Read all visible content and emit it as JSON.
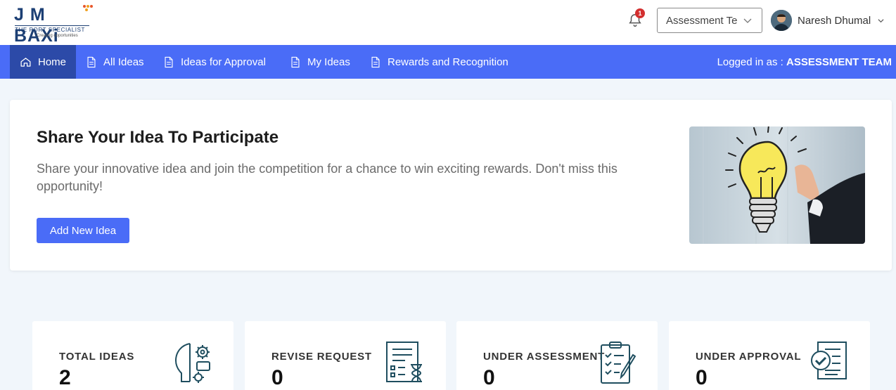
{
  "header": {
    "logo_brand": "J M BAXi",
    "logo_tagline": "THE PORT SPECIALIST",
    "logo_subtagline": "Creating opportunities",
    "notification_count": "1",
    "role_select_value": "Assessment Team",
    "user_name": "Naresh Dhumal"
  },
  "nav": {
    "items": [
      {
        "label": "Home",
        "icon": "home-icon"
      },
      {
        "label": "All Ideas",
        "icon": "document-icon"
      },
      {
        "label": "Ideas for Approval",
        "icon": "document-icon"
      },
      {
        "label": "My Ideas",
        "icon": "document-icon"
      },
      {
        "label": "Rewards and Recognition",
        "icon": "document-icon"
      }
    ],
    "logged_in_prefix": "Logged in as :",
    "logged_in_role": "ASSESSMENT TEAM"
  },
  "hero": {
    "title": "Share Your Idea To Participate",
    "description": "Share your innovative idea and join the competition for a chance to win exciting rewards. Don't miss this opportunity!",
    "button_label": "Add New Idea"
  },
  "stats": [
    {
      "label": "TOTAL IDEAS",
      "value": "2",
      "icon": "brain-gear-icon"
    },
    {
      "label": "REVISE REQUEST",
      "value": "0",
      "icon": "document-hourglass-icon"
    },
    {
      "label": "UNDER ASSESSMENT",
      "value": "0",
      "icon": "clipboard-checklist-icon"
    },
    {
      "label": "UNDER APPROVAL",
      "value": "0",
      "icon": "document-approved-icon"
    }
  ],
  "colors": {
    "primary": "#4a6cf7",
    "nav_active": "#2c4aa8",
    "page_bg": "#f1f6fb",
    "brand_navy": "#1c3f74",
    "icon_teal": "#1f4e5f",
    "badge_red": "#d32f2f"
  }
}
